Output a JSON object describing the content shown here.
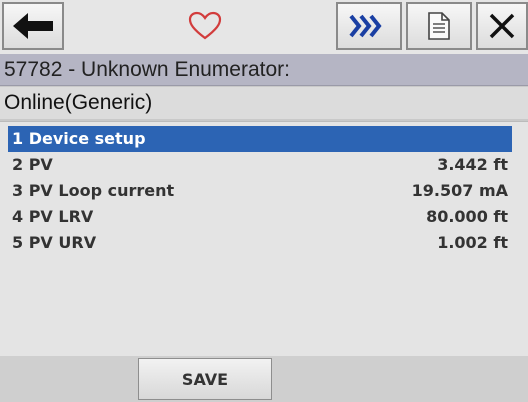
{
  "toolbar": {
    "back_icon": "back-arrow-icon",
    "favorite_icon": "heart-icon",
    "next_icon": "fast-forward-icon",
    "document_icon": "document-icon",
    "close_icon": "close-icon",
    "accent_color": "#2c64b4",
    "favorite_color": "#d23c3c"
  },
  "header": {
    "title": "57782 - Unknown Enumerator:"
  },
  "subheader": {
    "mode": "Online(Generic)"
  },
  "menu": {
    "items": [
      {
        "label": "1 Device setup",
        "value": "",
        "selected": true
      },
      {
        "label": "2 PV",
        "value": "3.442 ft",
        "selected": false
      },
      {
        "label": "3 PV Loop current",
        "value": "19.507 mA",
        "selected": false
      },
      {
        "label": "4 PV LRV",
        "value": "80.000 ft",
        "selected": false
      },
      {
        "label": "5 PV URV",
        "value": "1.002 ft",
        "selected": false
      }
    ]
  },
  "footer": {
    "save_label": "SAVE"
  }
}
